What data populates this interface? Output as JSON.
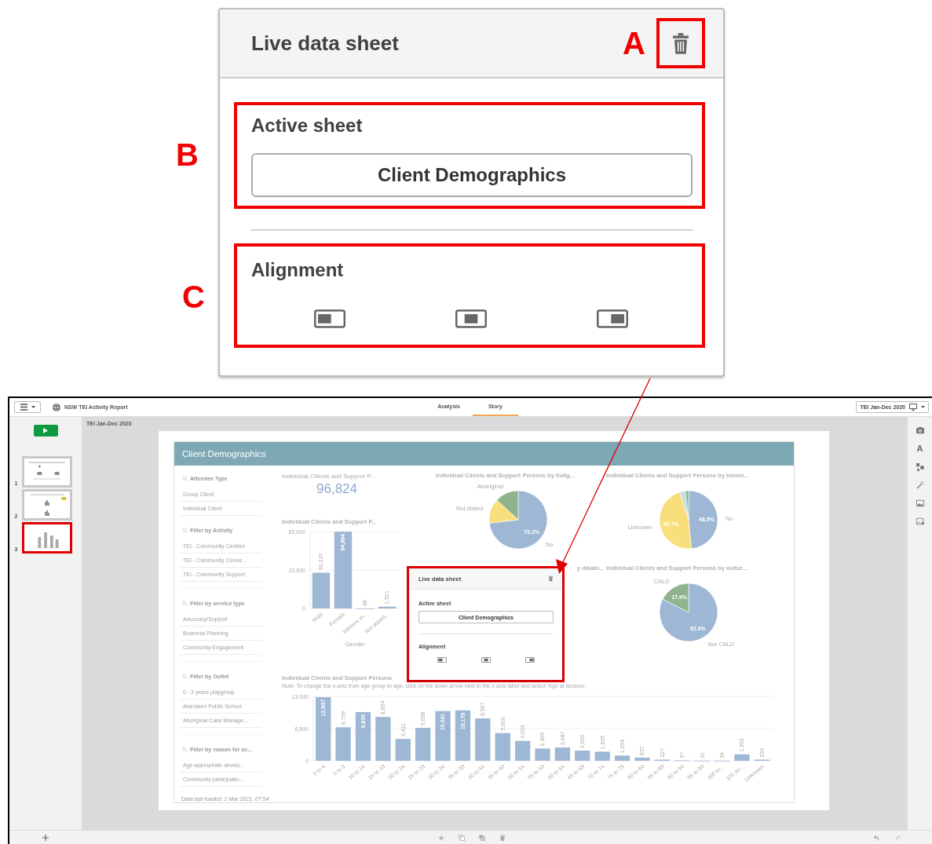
{
  "callout": {
    "title": "Live data sheet",
    "delete_marker": "A",
    "active_sheet": {
      "marker": "B",
      "label": "Active sheet",
      "value": "Client Demographics"
    },
    "alignment": {
      "marker": "C",
      "label": "Alignment",
      "options": [
        {
          "kind": "left"
        },
        {
          "kind": "center"
        },
        {
          "kind": "right"
        }
      ]
    }
  },
  "app": {
    "title": "NSW TEI Activity Report",
    "tabs": [
      {
        "label": "Analysis",
        "selected": false
      },
      {
        "label": "Story",
        "selected": true
      }
    ],
    "story_selector": "TEI Jan-Dec 2020",
    "story_title": "TEI Jan-Dec 2020",
    "text_tool": "A",
    "slides": [
      {
        "number": "1",
        "kind": "text",
        "selected": false
      },
      {
        "number": "2",
        "kind": "mixed",
        "selected": false
      },
      {
        "number": "3",
        "kind": "bars",
        "selected": true
      }
    ]
  },
  "sheet": {
    "title": "Client Demographics",
    "filters": [
      {
        "title": "Attendee Type",
        "items": [
          "Group Client",
          "Individual Client"
        ],
        "clipped": false
      },
      {
        "title": "Filter by Activity",
        "items": [
          "TEI - Community Centres",
          "TEI - Community Conne...",
          "TEI - Community Support"
        ],
        "clipped": true
      },
      {
        "title": "Filter by service type",
        "items": [
          "Advocacy/Support",
          "Business Planning",
          "Community Engagement"
        ],
        "clipped": true
      },
      {
        "title": "Filter by Outlet",
        "items": [
          "0 - 3 years playgroup",
          "Aberdeen Public School",
          "Aboriginal Case Manage..."
        ],
        "clipped": true
      },
      {
        "title": "Filter by reason for se...",
        "items": [
          "Age-appropriate develo...",
          "Community participatio..."
        ],
        "clipped": false
      }
    ],
    "kpi": {
      "title": "Individual Clients and Support P...",
      "value": "96,824"
    },
    "gender_chart": {
      "chart_data": {
        "type": "bar",
        "title": "Individual Clients and Support P...",
        "xlabel": "Gender",
        "categories": [
          "Male",
          "Female",
          "Intersex in...",
          "Not stated..."
        ],
        "values": [
          30219,
          64884,
          88,
          1521
        ],
        "ylim": [
          0,
          65000
        ],
        "yticks": [
          0,
          {
            "value": 32500,
            "label": "32,500"
          },
          {
            "value": 65000,
            "label": "65,000"
          }
        ],
        "value_labels": [
          "30,219",
          "64,884",
          "88",
          "1,521"
        ]
      }
    },
    "pies": [
      {
        "chart_data": {
          "type": "pie",
          "title": "Individual Clients and Support Persons by Indig...",
          "categories": [
            "No",
            "Not stated",
            "Aboriginal"
          ],
          "values": [
            73.2,
            13.6,
            13.2
          ],
          "colors": [
            "#9db7d4",
            "#f8df7b",
            "#8fb48d"
          ],
          "value_labels": [
            "73.2%",
            null,
            null
          ]
        }
      },
      {
        "chart_data": {
          "type": "pie",
          "title": "Individual Clients and Support Persons by homel...",
          "categories": [
            "No",
            "Unknown",
            null,
            null
          ],
          "values": [
            48.5,
            46.7,
            3.0,
            1.8
          ],
          "colors": [
            "#9db7d4",
            "#f8df7b",
            "#c5dcea",
            "#8fb48d"
          ],
          "value_labels": [
            "48.5%",
            "46.7%",
            null,
            null
          ]
        }
      },
      {
        "chart_data": {
          "type": "pie",
          "title": "Individual Clients and Support Persons by cultur...",
          "categories": [
            "Not CALD",
            "CALD"
          ],
          "values": [
            82.6,
            17.4
          ],
          "colors": [
            "#9db7d4",
            "#8fb48d"
          ],
          "value_labels": [
            "82.6%",
            "17.4%"
          ]
        }
      }
    ],
    "disability_title_fragment": "y disabi...",
    "age_chart": {
      "note": "Note: To change the x-axis from age group to age, click on the down arrow next to the x-axis label and select 'Age at session'.",
      "chart_data": {
        "type": "bar",
        "title": "Individual Clients and Support Persons",
        "categories": [
          "0 to 4",
          "5 to 9",
          "10 to 14",
          "15 to 19",
          "20 to 24",
          "25 to 29",
          "30 to 34",
          "35 to 39",
          "40 to 44",
          "45 to 49",
          "50 to 54",
          "55 to 59",
          "60 to 64",
          "65 to 69",
          "70 to 74",
          "75 to 79",
          "80 to 84",
          "85 to 89",
          "90 to 94",
          "95 to 99",
          "100 to...",
          "105 an...",
          "Unknown"
        ],
        "values": [
          12847,
          6759,
          9835,
          8854,
          4411,
          6658,
          10041,
          10179,
          8567,
          5600,
          4003,
          2465,
          2687,
          2060,
          1835,
          1054,
          637,
          227,
          97,
          31,
          34,
          1303,
          233
        ],
        "ylim": [
          0,
          13000
        ],
        "yticks": [
          0,
          {
            "value": 6500,
            "label": "6,500"
          },
          {
            "value": 13000,
            "label": "13,000"
          }
        ],
        "value_labels": [
          "12,847",
          "6,759",
          "9,835",
          "8,854",
          "4,411",
          "6,658",
          "10,041",
          "10,179",
          "8,567",
          "5,600",
          "4,003",
          "2,465",
          "2,687",
          "2,060",
          "1,835",
          "1,054",
          "637",
          "227",
          "97",
          "31",
          "34",
          "1,303",
          "233"
        ]
      }
    },
    "data_loaded": "Data last loaded: *2 Mar 2021, 07:54*"
  },
  "popup": {
    "title": "Live data sheet",
    "label": "Active sheet",
    "value": "Client Demographics",
    "alignment_label": "Alignment",
    "options": [
      {
        "kind": "left"
      },
      {
        "kind": "center"
      },
      {
        "kind": "right"
      }
    ]
  }
}
